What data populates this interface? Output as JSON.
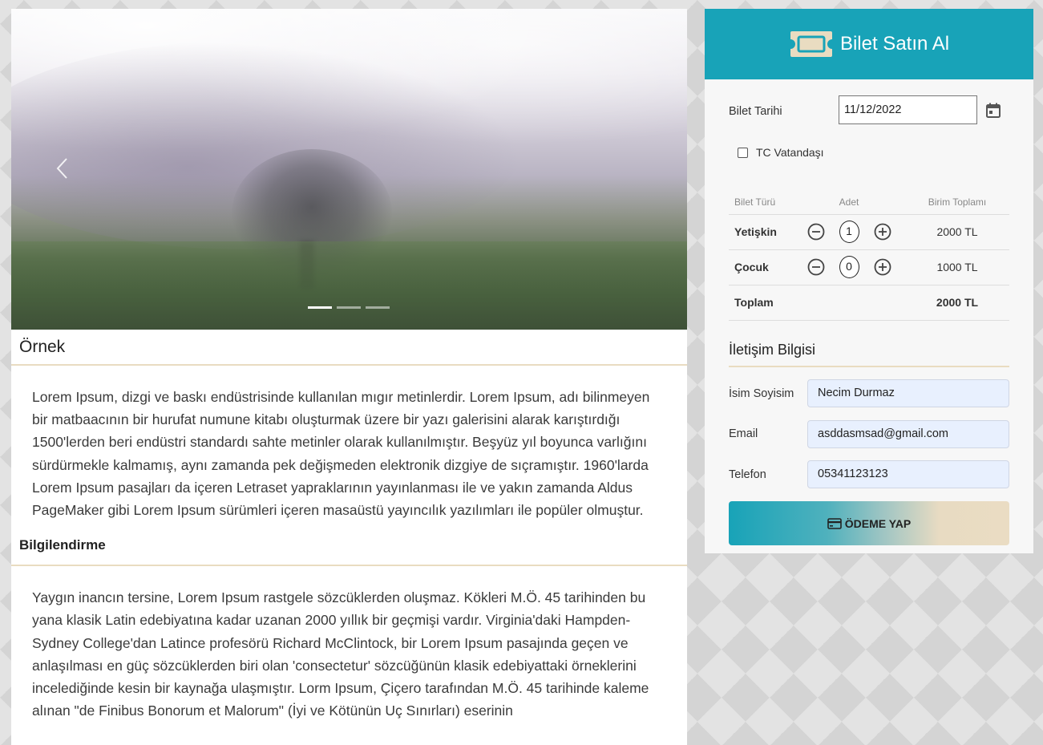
{
  "carousel": {
    "slide_count": 3,
    "active_index": 0
  },
  "content": {
    "title": "Örnek",
    "paragraph1": "Lorem Ipsum, dizgi ve baskı endüstrisinde kullanılan mıgır metinlerdir. Lorem Ipsum, adı bilinmeyen bir matbaacının bir hurufat numune kitabı oluşturmak üzere bir yazı galerisini alarak karıştırdığı 1500'lerden beri endüstri standardı sahte metinler olarak kullanılmıştır. Beşyüz yıl boyunca varlığını sürdürmekle kalmamış, aynı zamanda pek değişmeden elektronik dizgiye de sıçramıştır. 1960'larda Lorem Ipsum pasajları da içeren Letraset yapraklarının yayınlanması ile ve yakın zamanda Aldus PageMaker gibi Lorem Ipsum sürümleri içeren masaüstü yayıncılık yazılımları ile popüler olmuştur.",
    "subtitle": "Bilgilendirme",
    "paragraph2": "Yaygın inancın tersine, Lorem Ipsum rastgele sözcüklerden oluşmaz. Kökleri M.Ö. 45 tarihinden bu yana klasik Latin edebiyatına kadar uzanan 2000 yıllık bir geçmişi vardır. Virginia'daki Hampden-Sydney College'dan Latince profesörü Richard McClintock, bir Lorem Ipsum pasajında geçen ve anlaşılması en güç sözcüklerden biri olan 'consectetur' sözcüğünün klasik edebiyattaki örneklerini incelediğinde kesin bir kaynağa ulaşmıştır. Lorm Ipsum, Çiçero tarafından M.Ö. 45 tarihinde kaleme alınan \"de Finibus Bonorum et Malorum\" (İyi ve Kötünün Uç Sınırları) eserinin"
  },
  "ticket": {
    "header_title": "Bilet Satın Al",
    "header_icon": "ticket-icon",
    "date_label": "Bilet Tarihi",
    "date_value": "11/12/2022",
    "citizen_label": "TC Vatandaşı",
    "citizen_checked": false,
    "columns": [
      "Bilet Türü",
      "Adet",
      "Birim Toplamı"
    ],
    "rows": [
      {
        "type": "Yetişkin",
        "qty": "1",
        "total": "2000 TL"
      },
      {
        "type": "Çocuk",
        "qty": "0",
        "total": "1000 TL"
      }
    ],
    "total_label": "Toplam",
    "total_value": "2000 TL"
  },
  "contact": {
    "title": "İletişim Bilgisi",
    "name_label": "İsim Soyisim",
    "name_value": "Necim Durmaz",
    "email_label": "Email",
    "email_value": "asddasmsad@gmail.com",
    "phone_label": "Telefon",
    "phone_value": "05341123123"
  },
  "pay_button": {
    "label": "ÖDEME YAP",
    "icon": "credit-card-icon"
  },
  "colors": {
    "accent": "#18a3b8",
    "beige": "#e9dcc1",
    "field_bg": "#e8f0fe"
  }
}
